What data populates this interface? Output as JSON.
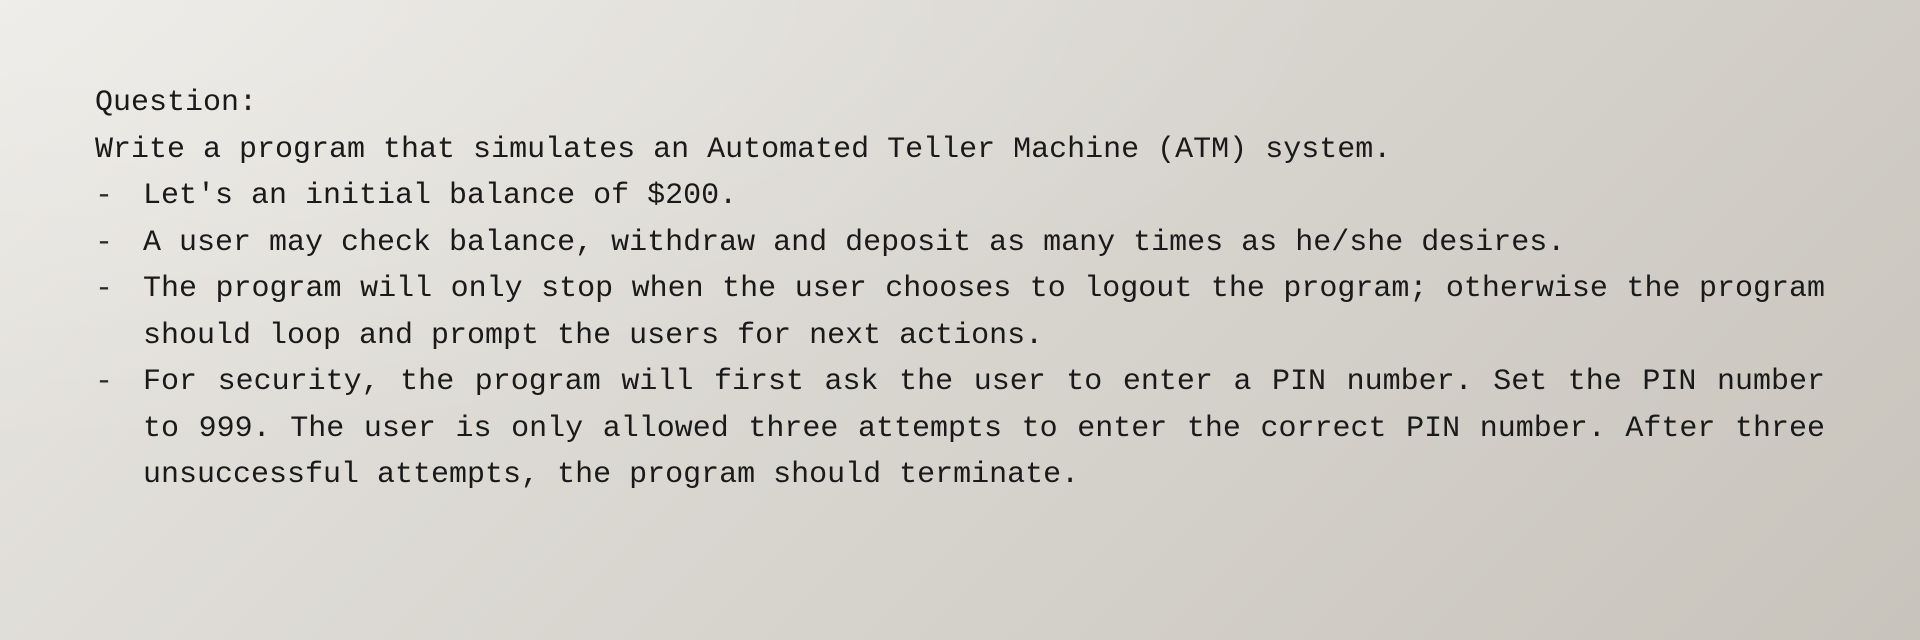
{
  "question": {
    "label": "Question:",
    "intro": "Write a program that simulates an Automated Teller Machine (ATM) system.",
    "bullets": [
      "Let's an initial balance of $200.",
      "A user may check balance, withdraw and deposit as many times as he/she desires.",
      "The program will only stop when the user chooses to logout the program; otherwise the program should loop and prompt the users for next actions.",
      "For security, the program will first ask the user to enter a PIN number. Set the PIN number to 999. The user is only allowed three attempts to enter the correct PIN number. After three unsuccessful attempts, the program should terminate."
    ]
  }
}
